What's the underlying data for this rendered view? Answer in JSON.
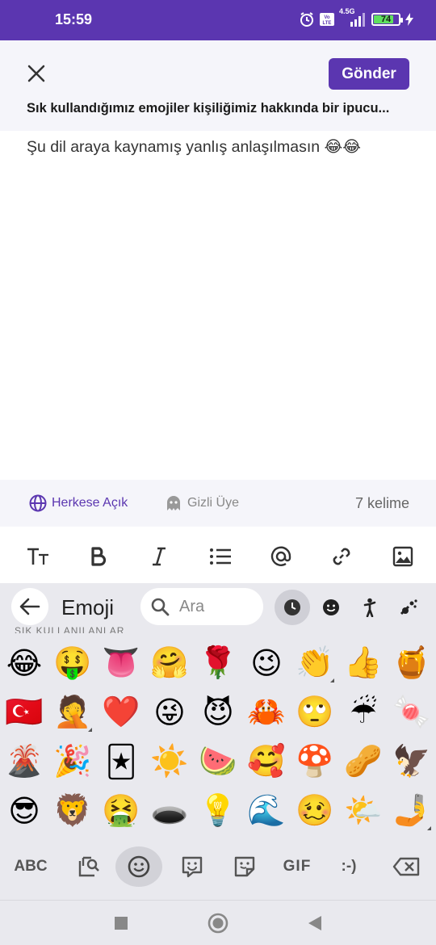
{
  "status_bar": {
    "time": "15:59",
    "network": "4.5G",
    "volte": "Vo LTE",
    "battery": "74",
    "battery_level": 0.74
  },
  "header": {
    "close_icon": "close-icon",
    "send_label": "Gönder",
    "question": "Sık kullandığımız emojiler kişiliğimiz hakkında bir ipucu..."
  },
  "answer": {
    "text": "Şu dil araya kaynamış yanlış anlaşılmasın 😂😂"
  },
  "footer": {
    "visibility_label": "Herkese Açık",
    "anonymous_label": "Gizli Üye",
    "word_count": "7 kelime"
  },
  "format_toolbar": [
    "text-size-icon",
    "bold-icon",
    "italic-icon",
    "list-icon",
    "mention-icon",
    "link-icon",
    "image-icon"
  ],
  "keyboard": {
    "title": "Emoji",
    "search_placeholder": "Ara",
    "section_peek": "SIK KULLANILANLAR",
    "emojis": [
      "😂",
      "🤑",
      "👅",
      "🤗",
      "🌹",
      "😉",
      "👏",
      "👍",
      "🍯",
      "🇹🇷",
      "🤦",
      "❤️",
      "😜",
      "😈",
      "🦀",
      "🙄",
      "☔",
      "🍬",
      "🌋",
      "🎉",
      "🃏",
      "☀️",
      "🍉",
      "🥰",
      "🍄",
      "🥜",
      "🦅",
      "😎",
      "🦁",
      "🤮",
      "🕳️",
      "💡",
      "🌊",
      "🥴",
      "🌤️",
      "🤳"
    ],
    "bottom_abc": "ABC",
    "bottom_gif": "GIF",
    "bottom_emoticon": ":-)"
  },
  "colors": {
    "brand": "#5b36b0",
    "battery_fill": "#5fe05f"
  }
}
